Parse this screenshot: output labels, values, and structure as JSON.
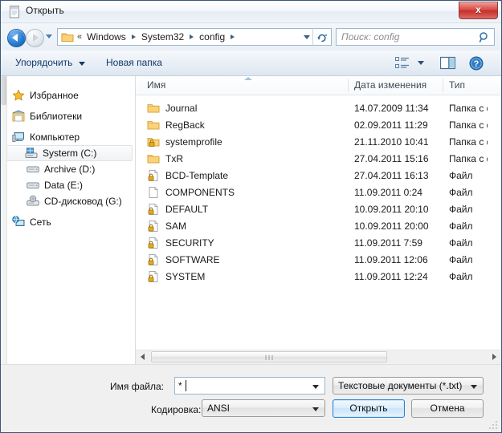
{
  "window": {
    "title": "Открыть",
    "title_icon": "notepad-document-icon",
    "close_label": "x"
  },
  "addressbar": {
    "back_icon": "back-arrow-icon",
    "forward_icon": "forward-arrow-icon",
    "recent_icon": "recent-pages-caret-icon",
    "folder_icon": "folder-icon",
    "overflow": "«",
    "crumbs": [
      "Windows",
      "System32",
      "config"
    ],
    "dropdown_icon": "address-dropdown-icon",
    "refresh_icon": "refresh-icon",
    "search_placeholder": "Поиск: config",
    "search_icon": "search-icon"
  },
  "commandbar": {
    "organize_label": "Упорядочить",
    "organize_caret_icon": "chevron-down-icon",
    "new_folder_label": "Новая папка",
    "view_icon": "view-list-icon",
    "view_caret_icon": "chevron-down-icon",
    "preview_pane_icon": "preview-pane-icon",
    "help_icon": "help-icon"
  },
  "sidebar": {
    "items": [
      {
        "label": "Избранное",
        "icon": "star-icon",
        "type": "group",
        "selected": false
      },
      {
        "label": "Библиотеки",
        "icon": "libraries-icon",
        "type": "group",
        "selected": false
      },
      {
        "label": "Компьютер",
        "icon": "computer-icon",
        "type": "group",
        "selected": false
      },
      {
        "label": "Systerm (C:)",
        "icon": "system-drive-icon",
        "type": "child",
        "selected": true
      },
      {
        "label": "Archive (D:)",
        "icon": "drive-icon",
        "type": "child",
        "selected": false
      },
      {
        "label": "Data (E:)",
        "icon": "drive-icon",
        "type": "child",
        "selected": false
      },
      {
        "label": "CD-дисковод (G:)",
        "icon": "cd-drive-icon",
        "type": "child",
        "selected": false
      },
      {
        "label": "Сеть",
        "icon": "network-icon",
        "type": "group",
        "selected": false
      }
    ]
  },
  "filelist": {
    "columns": [
      {
        "label": "Имя",
        "key": "name"
      },
      {
        "label": "Дата изменения",
        "key": "date"
      },
      {
        "label": "Тип",
        "key": "type"
      }
    ],
    "sort_indicator_icon": "sort-ascending-icon",
    "rows": [
      {
        "name": "Journal",
        "date": "14.07.2009 11:34",
        "type": "Папка с ф",
        "icon": "folder-icon"
      },
      {
        "name": "RegBack",
        "date": "02.09.2011 11:29",
        "type": "Папка с ф",
        "icon": "folder-icon"
      },
      {
        "name": "systemprofile",
        "date": "21.11.2010 10:41",
        "type": "Папка с ф",
        "icon": "folder-locked-icon"
      },
      {
        "name": "TxR",
        "date": "27.04.2011 15:16",
        "type": "Папка с ф",
        "icon": "folder-icon"
      },
      {
        "name": "BCD-Template",
        "date": "27.04.2011 16:13",
        "type": "Файл",
        "icon": "file-locked-icon"
      },
      {
        "name": "COMPONENTS",
        "date": "11.09.2011 0:24",
        "type": "Файл",
        "icon": "file-icon"
      },
      {
        "name": "DEFAULT",
        "date": "10.09.2011 20:10",
        "type": "Файл",
        "icon": "file-locked-icon"
      },
      {
        "name": "SAM",
        "date": "10.09.2011 20:00",
        "type": "Файл",
        "icon": "file-locked-icon"
      },
      {
        "name": "SECURITY",
        "date": "11.09.2011 7:59",
        "type": "Файл",
        "icon": "file-locked-icon"
      },
      {
        "name": "SOFTWARE",
        "date": "11.09.2011 12:06",
        "type": "Файл",
        "icon": "file-locked-icon"
      },
      {
        "name": "SYSTEM",
        "date": "11.09.2011 12:24",
        "type": "Файл",
        "icon": "file-locked-icon"
      }
    ],
    "hscroll": {
      "left_icon": "scroll-left-icon",
      "right_icon": "scroll-right-icon",
      "grip_icon": "scroll-grip-icon"
    }
  },
  "footer": {
    "filename_label": "Имя файла:",
    "filename_value": "*",
    "filename_dropdown_icon": "chevron-down-icon",
    "encoding_label": "Кодировка:",
    "encoding_value": "ANSI",
    "encoding_dropdown_icon": "chevron-down-icon",
    "filetype_value": "Текстовые документы (*.txt)",
    "filetype_dropdown_icon": "chevron-down-icon",
    "open_label": "Открыть",
    "cancel_label": "Отмена",
    "resize_grip_icon": "resize-grip-icon"
  },
  "colors": {
    "accent": "#2c85d1",
    "folder": "#fcd575",
    "title_text": "#1a1a1a",
    "command_text": "#14386b",
    "close_red": "#c32f29"
  }
}
